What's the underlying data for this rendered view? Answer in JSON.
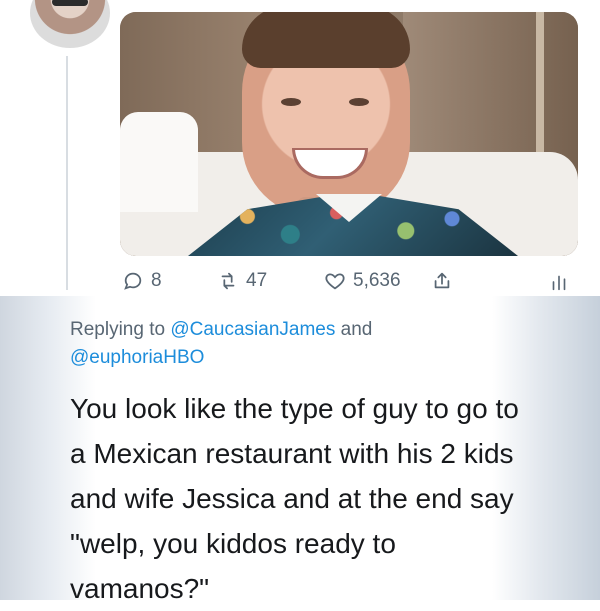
{
  "tweet": {
    "reply_count": "8",
    "retweet_count": "47",
    "like_count": "5,636",
    "replying_prefix": "Replying to ",
    "mention_1": "@CaucasianJames",
    "and": " and",
    "mention_2": "@euphoriaHBO",
    "text": "You look like the type of guy to go to\na Mexican restaurant with his 2 kids\nand wife Jessica and at the end say\n\"welp, you kiddos ready to\nvamanos?\""
  },
  "icons": {
    "reply": "reply-icon",
    "retweet": "retweet-icon",
    "like": "heart-icon",
    "share": "share-icon",
    "analytics": "analytics-icon"
  },
  "colors": {
    "text": "#17191c",
    "meta_text": "#586673",
    "mention": "#1d8ddb"
  }
}
